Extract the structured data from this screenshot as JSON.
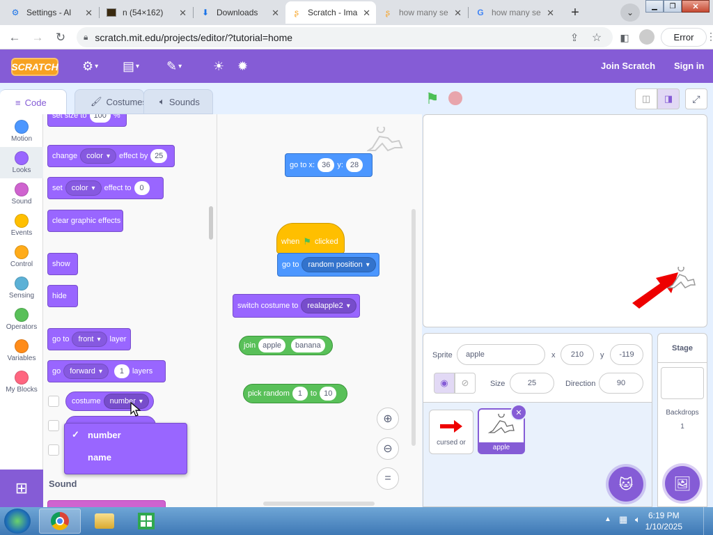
{
  "browser": {
    "tabs": [
      {
        "title": "Settings - Al",
        "icon": "gear-icon"
      },
      {
        "title": "n (54×162)",
        "icon": "image-icon"
      },
      {
        "title": "Downloads",
        "icon": "download-icon"
      },
      {
        "title": "Scratch - Ima",
        "icon": "scratch-icon",
        "active": true
      },
      {
        "title": "how many se",
        "icon": "scratch-icon"
      },
      {
        "title": "how many se",
        "icon": "google-icon"
      }
    ],
    "new_tab_label": "+",
    "url": "scratch.mit.edu/projects/editor/?tutorial=home",
    "error_label": "Error"
  },
  "menubar": {
    "logo": "SCRATCH",
    "join": "Join Scratch",
    "signin": "Sign in"
  },
  "editor_tabs": {
    "code": "Code",
    "costumes": "Costumes",
    "sounds": "Sounds"
  },
  "categories": [
    {
      "label": "Motion",
      "color": "#4c97ff"
    },
    {
      "label": "Looks",
      "color": "#9966ff"
    },
    {
      "label": "Sound",
      "color": "#cf63cf"
    },
    {
      "label": "Events",
      "color": "#ffbf00"
    },
    {
      "label": "Control",
      "color": "#ffab19"
    },
    {
      "label": "Sensing",
      "color": "#5cb1d6"
    },
    {
      "label": "Operators",
      "color": "#59c059"
    },
    {
      "label": "Variables",
      "color": "#ff8c1a"
    },
    {
      "label": "My Blocks",
      "color": "#ff6680"
    }
  ],
  "palette": {
    "set_size_to": "set size to",
    "set_size_value": "100",
    "set_size_pct": "%",
    "change_effect": {
      "a": "change",
      "effect": "color",
      "b": "effect by",
      "val": "25"
    },
    "set_effect": {
      "a": "set",
      "effect": "color",
      "b": "effect to",
      "val": "0"
    },
    "clear_effects": "clear graphic effects",
    "show": "show",
    "hide": "hide",
    "go_to_layer": {
      "a": "go to",
      "opt": "front",
      "b": "layer"
    },
    "go_layers": {
      "a": "go",
      "opt": "forward",
      "val": "1",
      "b": "layers"
    },
    "costume_reporter": {
      "a": "costume",
      "opt": "number"
    },
    "sound_heading": "Sound"
  },
  "dropdown": {
    "items": [
      "number",
      "name"
    ],
    "checked": "✓"
  },
  "script": {
    "goto_xy": {
      "a": "go to x:",
      "x": "36",
      "b": "y:",
      "y": "28"
    },
    "when_flag": {
      "a": "when",
      "b": "clicked"
    },
    "goto_random": {
      "a": "go to",
      "opt": "random position"
    },
    "switch_costume": {
      "a": "switch costume to",
      "opt": "realapple2"
    },
    "join": {
      "a": "join",
      "x": "apple",
      "y": "banana"
    },
    "pick_random": {
      "a": "pick random",
      "x": "1",
      "b": "to",
      "y": "10"
    }
  },
  "sprite_info": {
    "sprite_label": "Sprite",
    "sprite_name": "apple",
    "x_label": "x",
    "x": "210",
    "y_label": "y",
    "y": "-119",
    "show_label": "Show",
    "size_label": "Size",
    "size": "25",
    "direction_label": "Direction",
    "direction": "90"
  },
  "sprites": [
    {
      "name": "cursed or",
      "selected": false
    },
    {
      "name": "apple",
      "selected": true
    }
  ],
  "stage_panel": {
    "title": "Stage",
    "backdrops_label": "Backdrops",
    "backdrops_count": "1"
  },
  "taskbar": {
    "time": "6:19 PM",
    "date": "1/10/2025"
  }
}
